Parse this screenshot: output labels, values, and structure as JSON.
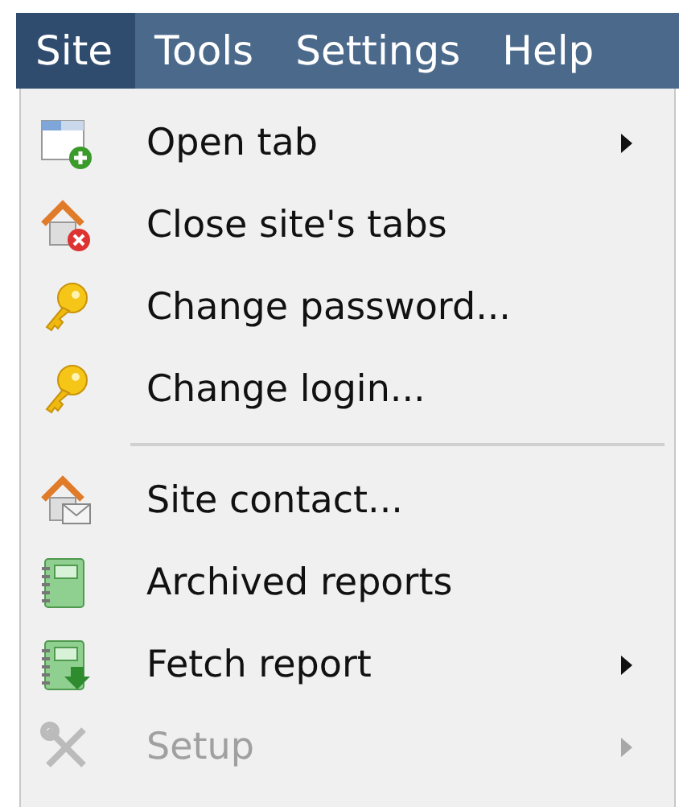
{
  "menubar": [
    {
      "label": "Site",
      "selected": true
    },
    {
      "label": "Tools",
      "selected": false
    },
    {
      "label": "Settings",
      "selected": false
    },
    {
      "label": "Help",
      "selected": false
    }
  ],
  "menu": [
    {
      "kind": "item",
      "label": "Open tab",
      "submenu": true,
      "disabled": false
    },
    {
      "kind": "item",
      "label": "Close site's tabs",
      "submenu": false,
      "disabled": false
    },
    {
      "kind": "item",
      "label": "Change password...",
      "submenu": false,
      "disabled": false
    },
    {
      "kind": "item",
      "label": "Change login...",
      "submenu": false,
      "disabled": false
    },
    {
      "kind": "separator"
    },
    {
      "kind": "item",
      "label": "Site contact...",
      "submenu": false,
      "disabled": false
    },
    {
      "kind": "item",
      "label": "Archived reports",
      "submenu": false,
      "disabled": false
    },
    {
      "kind": "item",
      "label": "Fetch report",
      "submenu": true,
      "disabled": false
    },
    {
      "kind": "item",
      "label": "Setup",
      "submenu": true,
      "disabled": true
    }
  ]
}
